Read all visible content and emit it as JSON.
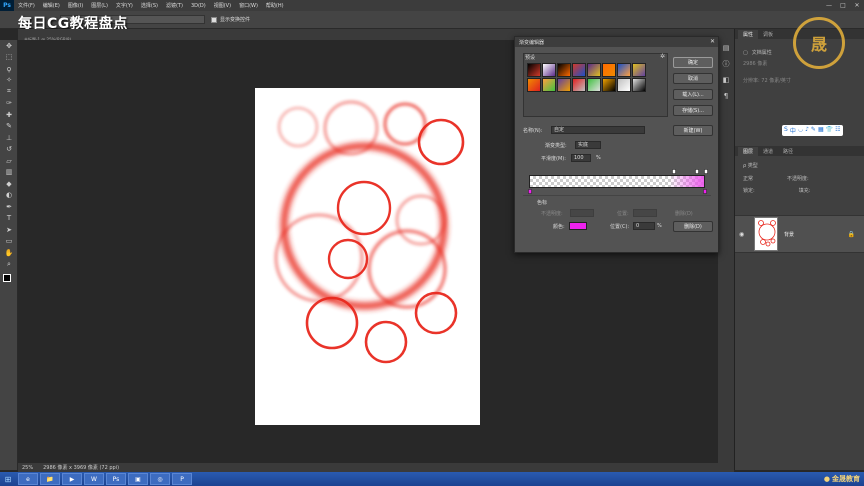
{
  "app": {
    "logo": "Ps",
    "overlay_title": "每日CG教程盘点",
    "menu": [
      "文件(F)",
      "编辑(E)",
      "图像(I)",
      "图层(L)",
      "文字(Y)",
      "选择(S)",
      "滤镜(T)",
      "3D(D)",
      "视图(V)",
      "窗口(W)",
      "帮助(H)"
    ],
    "window_controls": [
      "—",
      "□",
      "✕"
    ]
  },
  "options": {
    "show_transform_label": "显示变换控件"
  },
  "document": {
    "tab_label": "未标题-1 @ 25%(RGB/8)",
    "zoom": "25%",
    "size_info": "2986 像素 x 3969 像素 (72 ppi)"
  },
  "tools": [
    "move-icon",
    "marquee-icon",
    "lasso-icon",
    "wand-icon",
    "crop-icon",
    "eyedropper-icon",
    "heal-icon",
    "brush-icon",
    "stamp-icon",
    "history-brush-icon",
    "eraser-icon",
    "gradient-icon",
    "blur-icon",
    "dodge-icon",
    "pen-icon",
    "type-icon",
    "path-select-icon",
    "shape-icon",
    "hand-icon",
    "zoom-icon"
  ],
  "right_panel": {
    "top_tabs": [
      "属性",
      "调板"
    ],
    "props": [
      "文档属性",
      "2986 像素",
      "分辨率: 72 像素/英寸"
    ],
    "layer_tabs": [
      "图层",
      "通道",
      "路径"
    ],
    "layer_kind_label": "ρ 类型",
    "blend_mode": "正常",
    "opacity_label": "不透明度:",
    "lock_label": "锁定:",
    "fill_label": "填充:",
    "layer_name": "背景"
  },
  "ime": [
    "S",
    "中",
    "◡",
    "♪",
    "✎",
    "▦",
    "👕",
    "☷"
  ],
  "dialog": {
    "title": "渐变编辑器",
    "presets_label": "预设",
    "ok": "确定",
    "cancel": "取消",
    "load": "载入(L)...",
    "save": "存储(S)...",
    "name_label": "名称(N):",
    "name_value": "自定",
    "new_button": "新建(W)",
    "gradient_type_label": "渐变类型:",
    "gradient_type_value": "实底",
    "smoothness_label": "平滑度(M):",
    "smoothness_value": "100",
    "percent": "%",
    "stops_label": "色标",
    "opacity_label": "不透明度:",
    "opacity_location_label": "位置:",
    "opacity_delete": "删除(D)",
    "color_label": "颜色:",
    "color_location_label": "位置(C):",
    "color_location_value": "0",
    "color_delete": "删除(D)",
    "swatch_colors": [
      "#000000",
      "#ffffff",
      "#000000",
      "#d23a2a",
      "#5a2a8a",
      "#ff6a00",
      "#1a50c8",
      "#e0c020",
      "#f08a00",
      "#ffa040",
      "#6040a0",
      "#e02020",
      "#40c040",
      "#f0a000",
      "#c0c0c0",
      "#e0e0e0"
    ]
  },
  "taskbar": {
    "apps": [
      "e",
      "📁",
      "▶",
      "W",
      "Ps",
      "▣",
      "◎",
      "P"
    ],
    "brand": "金晟教育"
  },
  "colors": {
    "circle_red": "#e8281e",
    "gradient_magenta": "#ee22ee"
  }
}
